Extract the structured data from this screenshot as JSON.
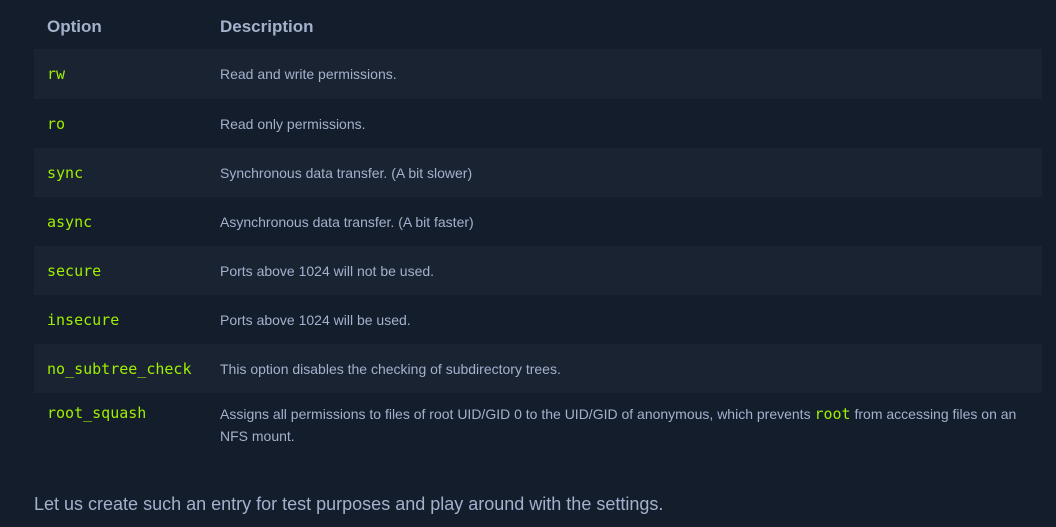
{
  "table": {
    "headers": {
      "option": "Option",
      "description": "Description"
    },
    "rows": [
      {
        "option": "rw",
        "description": "Read and write permissions."
      },
      {
        "option": "ro",
        "description": "Read only permissions."
      },
      {
        "option": "sync",
        "description": "Synchronous data transfer. (A bit slower)"
      },
      {
        "option": "async",
        "description": "Asynchronous data transfer. (A bit faster)"
      },
      {
        "option": "secure",
        "description": "Ports above 1024 will not be used."
      },
      {
        "option": "insecure",
        "description": "Ports above 1024 will be used."
      },
      {
        "option": "no_subtree_check",
        "description": "This option disables the checking of subdirectory trees."
      },
      {
        "option": "root_squash",
        "description_before": "Assigns all permissions to files of root UID/GID 0 to the UID/GID of anonymous, which prevents ",
        "description_code": "root",
        "description_after": " from accessing files on an NFS mount."
      }
    ]
  },
  "outro": "Let us create such an entry for test purposes and play around with the settings.",
  "colors": {
    "background": "#141d2b",
    "row_shade": "#1a2332",
    "text": "#a4b1cd",
    "code": "#9fef00"
  }
}
